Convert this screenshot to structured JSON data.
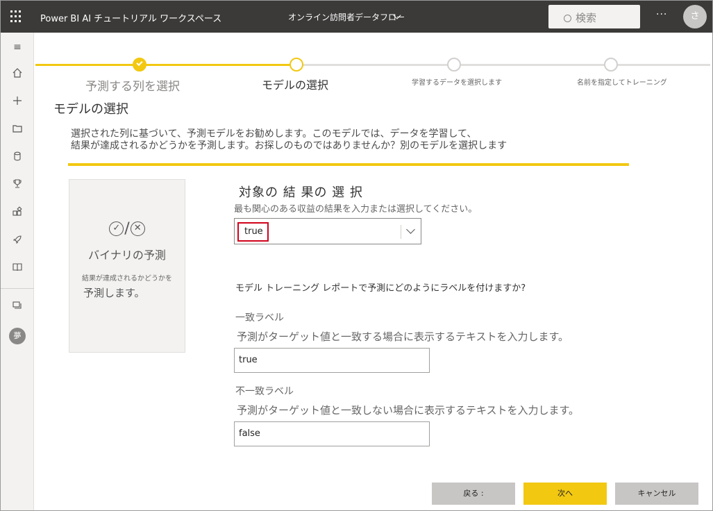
{
  "header": {
    "app_title": "Power BI AI チュートリアル ワークスペース",
    "dataflow_name": "オンライン訪問者データフロー",
    "search_placeholder": "検索",
    "more_label": "···",
    "avatar_initial": "さ"
  },
  "rail": {
    "menu_glyph": "≡",
    "avatar_initial": "夢"
  },
  "steps": [
    {
      "label": "予測する列を選択",
      "state": "done"
    },
    {
      "label": "モデルの選択",
      "state": "current"
    },
    {
      "label": "学習するデータを選択します",
      "state": "todo"
    },
    {
      "label": "名前を指定してトレーニング",
      "state": "todo"
    }
  ],
  "page_title": "モデルの選択",
  "banner": {
    "line1": "選択された列に基づいて、予測モデルをお勧めします。このモデルでは、データを学習して、",
    "line2": "結果が達成されるかどうかを予測します。お探しのものではありませんか？別のモデルを選択します"
  },
  "model_card": {
    "title": "バイナリの予測",
    "desc_line1": "結果が達成されるかどうかを",
    "desc_line2": "予測します。"
  },
  "outcome": {
    "title": "対象の 結 果の 選 択",
    "hint": "最も関心のある収益の結果を入力または選択してください。",
    "selected_value": "true"
  },
  "labels_section": {
    "question": "モデル トレーニング レポートで予測にどのようにラベルを付けますか?",
    "match_label": "一致ラベル",
    "match_hint": "予測がターゲット値と一致する場合に表示するテキストを入力します。",
    "match_value": "true",
    "mismatch_label": "不一致ラベル",
    "mismatch_hint": "予測がターゲット値と一致しない場合に表示するテキストを入力します。",
    "mismatch_value": "false"
  },
  "footer": {
    "back_label": "戻る :",
    "next_label": "次へ",
    "cancel_label": "キャンセル"
  },
  "colors": {
    "accent": "#f2c811",
    "topbar": "#3b3a39",
    "highlight_border": "#d0021b"
  }
}
